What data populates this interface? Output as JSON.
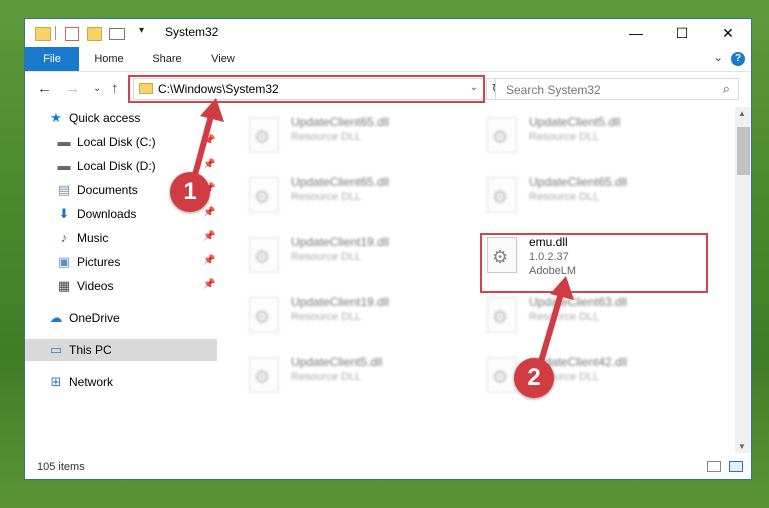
{
  "window": {
    "title": "System32"
  },
  "ribbon": {
    "tabs": [
      "File",
      "Home",
      "Share",
      "View"
    ]
  },
  "address": {
    "path": "C:\\Windows\\System32"
  },
  "search": {
    "placeholder": "Search System32"
  },
  "sidebar": {
    "items": [
      {
        "label": "Quick access",
        "icon": "star-icon",
        "pinned": false
      },
      {
        "label": "Local Disk (C:)",
        "icon": "drive-icon",
        "pinned": true
      },
      {
        "label": "Local Disk (D:)",
        "icon": "drive-icon",
        "pinned": true
      },
      {
        "label": "Documents",
        "icon": "documents-icon",
        "pinned": true
      },
      {
        "label": "Downloads",
        "icon": "download-icon",
        "pinned": true
      },
      {
        "label": "Music",
        "icon": "music-icon",
        "pinned": true
      },
      {
        "label": "Pictures",
        "icon": "pictures-icon",
        "pinned": true
      },
      {
        "label": "Videos",
        "icon": "videos-icon",
        "pinned": true
      },
      {
        "label": "OneDrive",
        "icon": "cloud-icon",
        "pinned": false
      },
      {
        "label": "This PC",
        "icon": "computer-icon",
        "pinned": false,
        "selected": true
      },
      {
        "label": "Network",
        "icon": "network-icon",
        "pinned": false
      }
    ]
  },
  "files": [
    {
      "name": "UpdateClient65.dll",
      "desc": "Resource DLL",
      "blurred": true
    },
    {
      "name": "UpdateClient5.dll",
      "desc": "Resource DLL",
      "blurred": true
    },
    {
      "name": "UpdateClient65.dll",
      "desc": "Resource DLL",
      "blurred": true
    },
    {
      "name": "UpdateClient65.dll",
      "desc": "Resource DLL",
      "blurred": true
    },
    {
      "name": "UpdateClient19.dll",
      "desc": "Resource DLL",
      "blurred": true
    },
    {
      "name": "emu.dll",
      "desc": "1.0.2.37",
      "company": "AdobeLM",
      "blurred": false
    },
    {
      "name": "UpdateClient19.dll",
      "desc": "Resource DLL",
      "blurred": true
    },
    {
      "name": "UpdateClient63.dll",
      "desc": "Resource DLL",
      "blurred": true
    },
    {
      "name": "UpdateClient5.dll",
      "desc": "Resource DLL",
      "blurred": true
    },
    {
      "name": "UpdateClient42.dll",
      "desc": "Resource DLL",
      "blurred": true
    }
  ],
  "status": {
    "count": "105 items"
  },
  "annotations": [
    {
      "label": "1"
    },
    {
      "label": "2"
    }
  ],
  "colors": {
    "accent": "#1979ca",
    "annotation_red": "#d0454b"
  }
}
